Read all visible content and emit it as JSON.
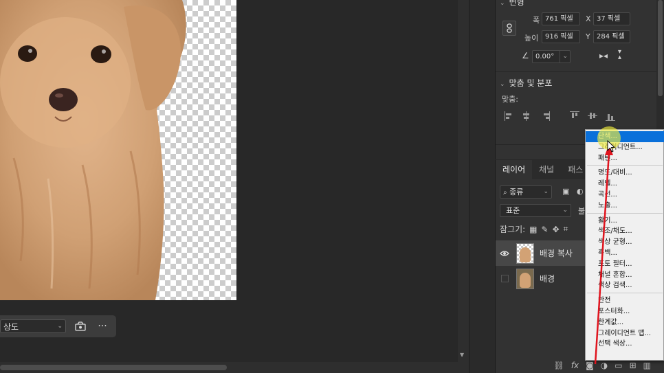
{
  "canvas": {
    "context_bar": {
      "select_value": "상도",
      "more_label": "···"
    },
    "image_subject": "dog"
  },
  "properties": {
    "transform_title": "변형",
    "width_label": "폭",
    "width_value": "761 픽셀",
    "height_label": "높이",
    "height_value": "916 픽셀",
    "x_label": "X",
    "x_value": "37 픽셀",
    "y_label": "Y",
    "y_value": "284 픽셀",
    "angle_value": "0.00°",
    "align_title": "맞춤 및 분포",
    "align_sub": "맞춤:"
  },
  "layers": {
    "tabs": [
      "레이어",
      "채널",
      "패스"
    ],
    "filter_label": "종류",
    "blend_mode": "표준",
    "lock_label": "잠그기:",
    "items": [
      {
        "name": "배경 복사",
        "visible": true,
        "selected": true
      },
      {
        "name": "배경",
        "visible": false,
        "selected": false
      }
    ],
    "bottom_icons": [
      "link-icon",
      "fx-icon",
      "mask-icon",
      "adjustment-icon",
      "group-icon",
      "new-layer-icon",
      "trash-icon"
    ]
  },
  "adjustment_menu": {
    "items": [
      {
        "label": "단색...",
        "highlighted": true
      },
      {
        "label": "그레이디언트...",
        "highlighted": false
      },
      {
        "label": "패턴...",
        "highlighted": false
      },
      {
        "sep": true
      },
      {
        "label": "명도/대비...",
        "highlighted": false
      },
      {
        "label": "레벨...",
        "highlighted": false
      },
      {
        "label": "곡선...",
        "highlighted": false
      },
      {
        "label": "노출...",
        "highlighted": false
      },
      {
        "sep": true
      },
      {
        "label": "활기...",
        "highlighted": false
      },
      {
        "label": "색조/채도...",
        "highlighted": false
      },
      {
        "label": "색상 균형...",
        "highlighted": false
      },
      {
        "label": "흑백...",
        "highlighted": false
      },
      {
        "label": "포토 필터...",
        "highlighted": false
      },
      {
        "label": "채널 혼합...",
        "highlighted": false
      },
      {
        "label": "색상 검색...",
        "highlighted": false
      },
      {
        "sep": true
      },
      {
        "label": "반전",
        "highlighted": false
      },
      {
        "label": "포스터화...",
        "highlighted": false
      },
      {
        "label": "한계값...",
        "highlighted": false
      },
      {
        "label": "그레이디언트 맵...",
        "highlighted": false
      },
      {
        "label": "선택 색상...",
        "highlighted": false
      }
    ]
  },
  "colors": {
    "accent": "#0a70da",
    "annotation_arrow": "#e0141e",
    "highlight": "#f0ec3c"
  }
}
